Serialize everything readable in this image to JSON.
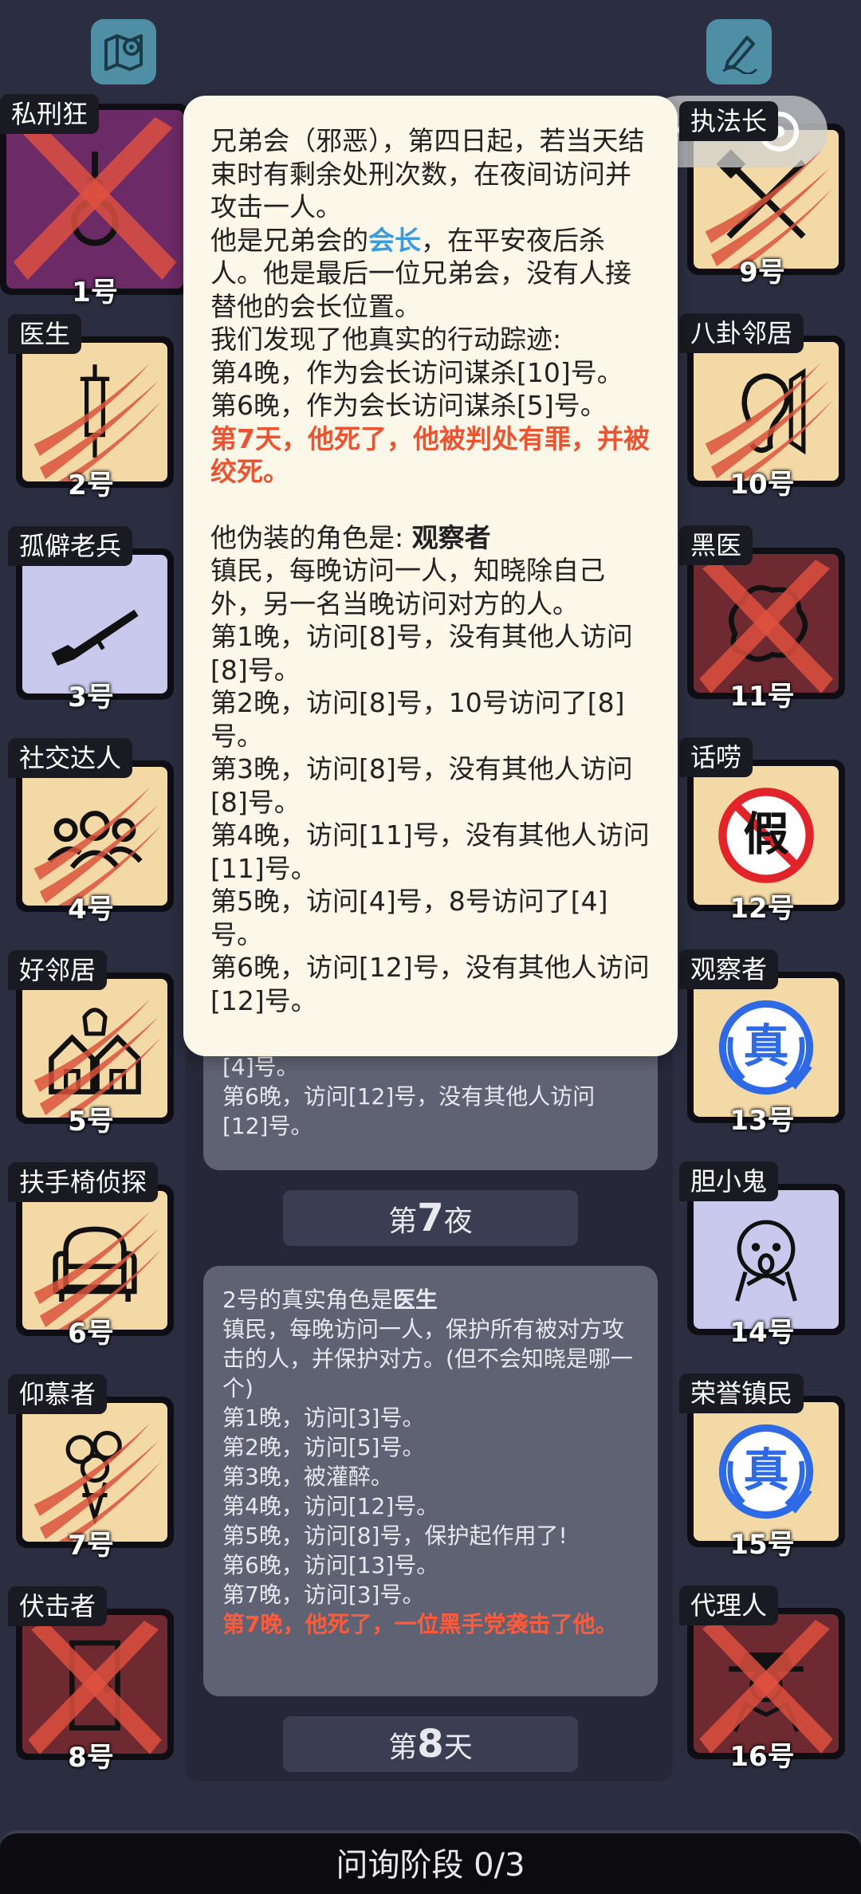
{
  "top": {
    "left_icon": "map-pin-icon",
    "right_icon": "pen-icon"
  },
  "capsule": {
    "dots": "•••"
  },
  "players_left": [
    {
      "role": "私刑狂",
      "num": "1号",
      "face": "purp",
      "icon": "noose-icon",
      "dead": "x"
    },
    {
      "role": "医生",
      "num": "2号",
      "face": "tan",
      "icon": "syringe-icon",
      "dead": "claw"
    },
    {
      "role": "孤僻老兵",
      "num": "3号",
      "face": "lav",
      "icon": "rifle-icon",
      "dead": ""
    },
    {
      "role": "社交达人",
      "num": "4号",
      "face": "tan",
      "icon": "people-icon",
      "dead": "claw"
    },
    {
      "role": "好邻居",
      "num": "5号",
      "face": "tan",
      "icon": "houses-icon",
      "dead": "claw"
    },
    {
      "role": "扶手椅侦探",
      "num": "6号",
      "face": "tan",
      "icon": "armchair-icon",
      "dead": "claw"
    },
    {
      "role": "仰慕者",
      "num": "7号",
      "face": "tan",
      "icon": "bouquet-icon",
      "dead": "claw"
    },
    {
      "role": "伏击者",
      "num": "8号",
      "face": "red",
      "icon": "door-icon",
      "dead": "x"
    }
  ],
  "players_right": [
    {
      "role": "执法长",
      "num": "9号",
      "face": "tan",
      "icon": "gavel-icon",
      "dead": "claw"
    },
    {
      "role": "八卦邻居",
      "num": "10号",
      "face": "tan",
      "icon": "ear-icon",
      "dead": "claw"
    },
    {
      "role": "黑医",
      "num": "11号",
      "face": "red",
      "icon": "brain-icon",
      "dead": "x"
    },
    {
      "role": "话唠",
      "num": "12号",
      "face": "tan",
      "icon": "no-fake-icon",
      "dead": "",
      "badge": "假"
    },
    {
      "role": "观察者",
      "num": "13号",
      "face": "tan",
      "icon": "true-badge-icon",
      "dead": "",
      "badge": "真"
    },
    {
      "role": "胆小鬼",
      "num": "14号",
      "face": "lav",
      "icon": "scared-face-icon",
      "dead": ""
    },
    {
      "role": "荣誉镇民",
      "num": "15号",
      "face": "tan",
      "icon": "true-badge-icon",
      "dead": "",
      "badge": "真"
    },
    {
      "role": "代理人",
      "num": "16号",
      "face": "red",
      "icon": "agent-icon",
      "dead": "x"
    }
  ],
  "popup": {
    "p1": "兄弟会（邪恶），第四日起，若当天结束时有剩余处刑次数，在夜间访问并攻击一人。",
    "p2_a": "他是兄弟会的",
    "p2_hl": "会长",
    "p2_b": "，在平安夜后杀人。他是最后一位兄弟会，没有人接替他的会长位置。",
    "p3": "我们发现了他真实的行动踪迹:",
    "p4": "第4晚，作为会长访问谋杀[10]号。",
    "p5": "第6晚，作为会长访问谋杀[5]号。",
    "p6": "第7天，他死了，他被判处有罪，并被绞死。",
    "p7_a": "他伪装的角色是: ",
    "p7_b": "观察者",
    "p8": "镇民，每晚访问一人，知晓除自己外，另一名当晚访问对方的人。",
    "lines": [
      "第1晚，访问[8]号，没有其他人访问[8]号。",
      "第2晚，访问[8]号，10号访问了[8]号。",
      "第3晚，访问[8]号，没有其他人访问[8]号。",
      "第4晚，访问[11]号，没有其他人访问[11]号。",
      "第5晚，访问[4]号，8号访问了[4]号。",
      "第6晚，访问[12]号，没有其他人访问[12]号。"
    ]
  },
  "log": {
    "box1": [
      "[4]号。",
      "第6晚，访问[12]号，没有其他人访问",
      "[12]号。"
    ],
    "phase1_pre": "第",
    "phase1_num": "7",
    "phase1_post": "夜",
    "box2_title_a": "2号的真实角色是",
    "box2_title_b": "医生",
    "box2_desc": "镇民，每晚访问一人，保护所有被对方攻击的人，并保护对方。(但不会知晓是哪一个)",
    "box2_lines": [
      "第1晚，访问[3]号。",
      "第2晚，访问[5]号。",
      "第3晚，被灌醉。",
      "第4晚，访问[12]号。",
      "第5晚，访问[8]号，保护起作用了!",
      "第6晚，访问[13]号。",
      "第7晚，访问[3]号。"
    ],
    "box2_kill": "第7晚，他死了，一位黑手党袭击了他。",
    "phase2_pre": "第",
    "phase2_num": "8",
    "phase2_post": "天"
  },
  "bottom": {
    "label": "问询阶段 0/3"
  },
  "colors": {
    "bg": "#2b2e40",
    "kill": "#ff5a3a",
    "highlight": "#3a9be0",
    "popup_bg": "#fbf8ea"
  }
}
